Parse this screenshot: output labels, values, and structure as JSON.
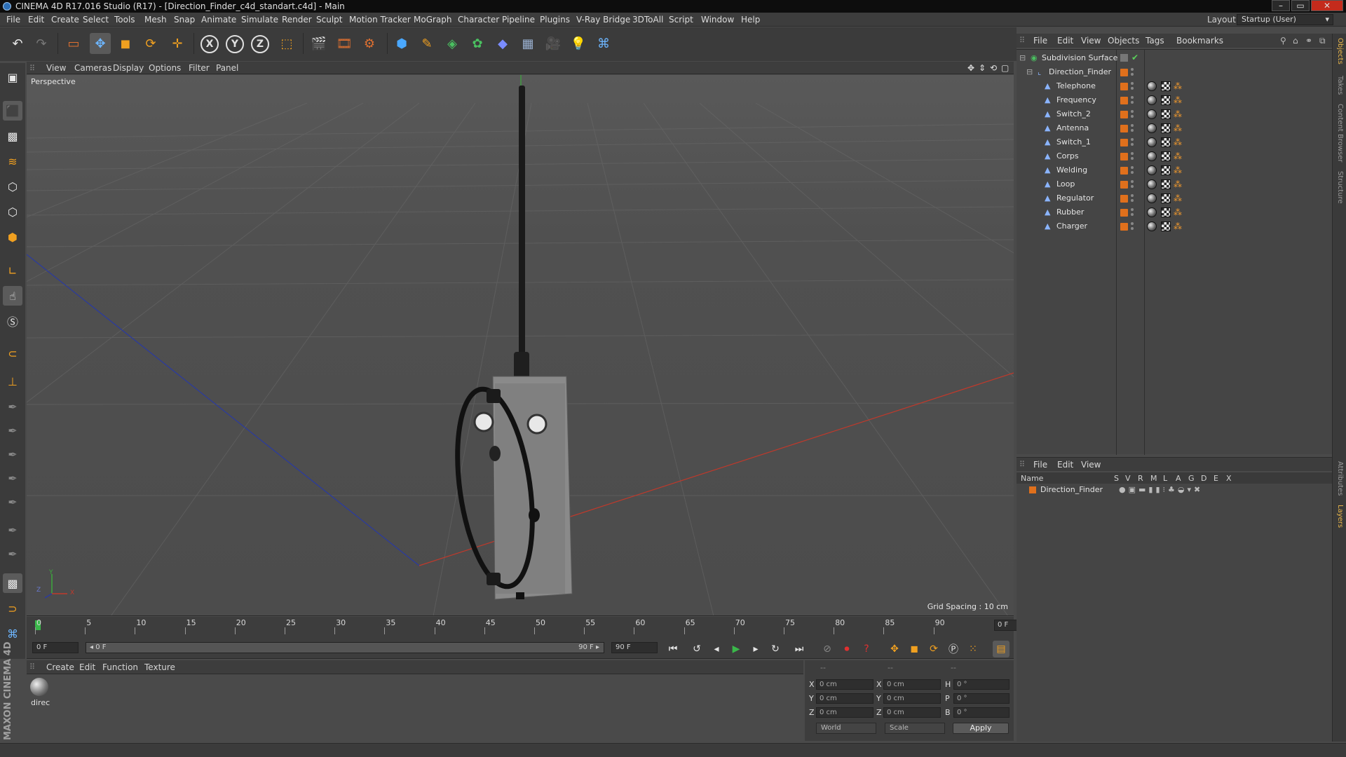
{
  "window": {
    "title": "CINEMA 4D R17.016 Studio (R17) - [Direction_Finder_c4d_standart.c4d] - Main",
    "controls": [
      "–",
      "▭",
      "✕"
    ]
  },
  "menubar": {
    "items": [
      "File",
      "Edit",
      "Create",
      "Select",
      "Tools",
      "Mesh",
      "Snap",
      "Animate",
      "Simulate",
      "Render",
      "Sculpt",
      "Motion Tracker",
      "MoGraph",
      "Character",
      "Pipeline",
      "Plugins",
      "V-Ray Bridge",
      "3DToAll",
      "Script",
      "Window",
      "Help"
    ],
    "layout_label": "Layout:",
    "layout_value": "Startup (User)"
  },
  "viewport": {
    "menu": [
      "View",
      "Cameras",
      "Display",
      "Options",
      "Filter",
      "Panel"
    ],
    "label": "Perspective",
    "grid_spacing": "Grid Spacing : 10 cm",
    "axis_labels": [
      "Y",
      "Z",
      "X"
    ]
  },
  "timeline": {
    "ticks": [
      "0",
      "5",
      "10",
      "15",
      "20",
      "25",
      "30",
      "35",
      "40",
      "45",
      "50",
      "55",
      "60",
      "65",
      "70",
      "75",
      "80",
      "85",
      "90"
    ],
    "current_frame": "0 F"
  },
  "transport": {
    "start_field": "0 F",
    "range_start": "◂ 0 F",
    "range_end": "90 F ▸",
    "end_field": "90 F"
  },
  "material_manager": {
    "menu": [
      "Create",
      "Edit",
      "Function",
      "Texture"
    ],
    "material_name": "direc"
  },
  "coordinates": {
    "headers": [
      "--",
      "--",
      "--"
    ],
    "rows": [
      {
        "a": "X",
        "av": "0 cm",
        "b": "X",
        "bv": "0 cm",
        "c": "H",
        "cv": "0 °"
      },
      {
        "a": "Y",
        "av": "0 cm",
        "b": "Y",
        "bv": "0 cm",
        "c": "P",
        "cv": "0 °"
      },
      {
        "a": "Z",
        "av": "0 cm",
        "b": "Z",
        "bv": "0 cm",
        "c": "B",
        "cv": "0 °"
      }
    ],
    "mode": "World",
    "scale": "Scale",
    "apply": "Apply"
  },
  "object_manager": {
    "menu": [
      "File",
      "Edit",
      "View",
      "Objects",
      "Tags",
      "Bookmarks"
    ],
    "root": "Subdivision Surface",
    "group": "Direction_Finder",
    "children": [
      "Telephone",
      "Frequency",
      "Switch_2",
      "Antenna",
      "Switch_1",
      "Corps",
      "Welding",
      "Loop",
      "Regulator",
      "Rubber",
      "Charger"
    ]
  },
  "layer_manager": {
    "menu": [
      "File",
      "Edit",
      "View"
    ],
    "columns": [
      "Name",
      "S",
      "V",
      "R",
      "M",
      "L",
      "A",
      "G",
      "D",
      "E",
      "X"
    ],
    "layer": "Direction_Finder"
  },
  "side_tabs": [
    "Objects",
    "Takes",
    "Content Browser",
    "Structure",
    "Attributes",
    "Layers"
  ],
  "branding": "MAXON CINEMA 4D",
  "colors": {
    "layer_orange": "#e0701c",
    "axis_red": "#c0392b",
    "axis_blue": "#2a3aa0",
    "axis_green": "#3ca83c"
  }
}
